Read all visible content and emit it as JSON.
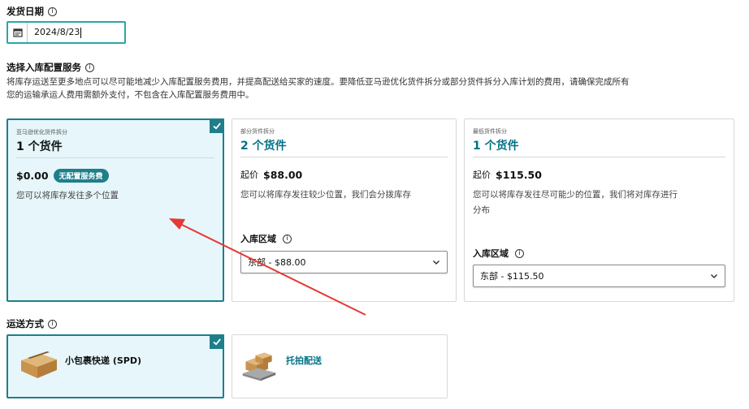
{
  "ship_date": {
    "label": "发货日期",
    "value": "2024/8/23"
  },
  "placement": {
    "label": "选择入库配置服务",
    "description_line1": "将库存运送至更多地点可以尽可能地减少入库配置服务费用，并提高配送给买家的速度。要降低亚马逊优化货件拆分或部分货件拆分入库计划的费用，请确保完成所有",
    "description_line2": "您的运输承运人费用需额外支付，不包含在入库配置服务费用中。",
    "options": [
      {
        "small": "亚马逊优化货件拆分",
        "title": "1 个货件",
        "price": "$0.00",
        "badge": "无配置服务费",
        "text": "您可以将库存发往多个位置"
      },
      {
        "small": "部分货件拆分",
        "title": "2 个货件",
        "price_prefix": "起价",
        "price": "$88.00",
        "text": "您可以将库存发往较少位置，我们会分拨库存",
        "region_label": "入库区域",
        "region_value": "东部 - $88.00"
      },
      {
        "small": "最低货件拆分",
        "title": "1 个货件",
        "price_prefix": "起价",
        "price": "$115.50",
        "text_line1": "您可以将库存发往尽可能少的位置，我们将对库存进行",
        "text_line2": "分布",
        "region_label": "入库区域",
        "region_value": "东部 - $115.50"
      }
    ]
  },
  "shipping": {
    "label": "运送方式",
    "options": [
      {
        "label": "小包裹快递 (SPD)"
      },
      {
        "label": "托拍配送"
      }
    ]
  },
  "colors": {
    "accent": "#1e7f8b",
    "link": "#007185",
    "selected_bg": "#e6f6fb",
    "arrow": "#e53935"
  }
}
